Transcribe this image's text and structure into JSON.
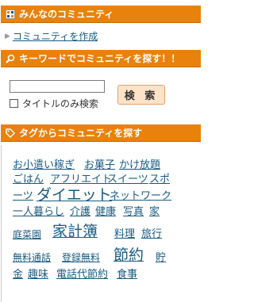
{
  "sections": {
    "community": {
      "title": "みんなのコミュニティ"
    },
    "keyword": {
      "title": "キーワードでコミュニティを探す！！"
    },
    "tag": {
      "title": "タグからコミュニティを探す"
    }
  },
  "create_link": "コミュニティを作成",
  "search": {
    "input_value": "",
    "button_label": "検 索",
    "checkbox_label": "タイトルのみ検索",
    "checkbox_checked": false
  },
  "tags": [
    "お小遣い稼ぎ",
    "お菓子",
    "かけ放題",
    "ごはん",
    "アフリエイト",
    "スイーツ",
    "スポ",
    "ーツ",
    "ダイエット",
    "ネットワーク",
    "一人暮らし",
    "介護",
    "健康",
    "写真",
    "家",
    "庭菜園",
    "家計簿",
    "料理",
    "旅行",
    "無料通話",
    "登録無料",
    "節約",
    "貯",
    "金",
    "趣味",
    "電話代節約",
    "食事"
  ],
  "colors": {
    "header_bg": "#e8820c",
    "link": "#1a5a80",
    "button_bg": "#fde3c8"
  },
  "icons": [
    "community-icon",
    "search-icon",
    "tag-icon",
    "arrow-right-icon"
  ]
}
